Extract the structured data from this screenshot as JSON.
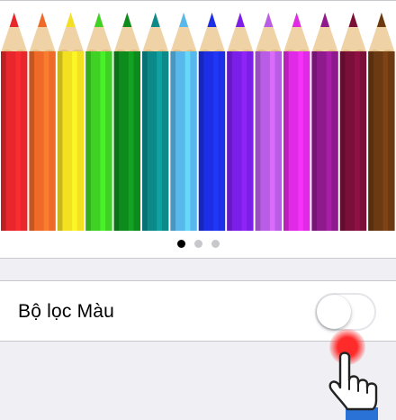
{
  "screen": {
    "background_color": "#efeff4",
    "card_color": "#ffffff"
  },
  "color_preview": {
    "image": "colored-pencils",
    "pencil_colors": [
      "#e8262b",
      "#ef6a28",
      "#f2e021",
      "#3fd124",
      "#0e8b1d",
      "#0c8a8a",
      "#58b8ec",
      "#1c2fe6",
      "#7b1ee8",
      "#b95de6",
      "#e12ae6",
      "#8e1a8e",
      "#7a0f3a",
      "#6b3a12"
    ],
    "page_indicator": {
      "pages": 3,
      "current": 1
    }
  },
  "color_filter_row": {
    "label": "Bộ lọc Màu",
    "toggle_on": false
  },
  "gesture_hint": {
    "icon": "pointing-hand-icon",
    "tap_color": "#ff2a2a"
  }
}
